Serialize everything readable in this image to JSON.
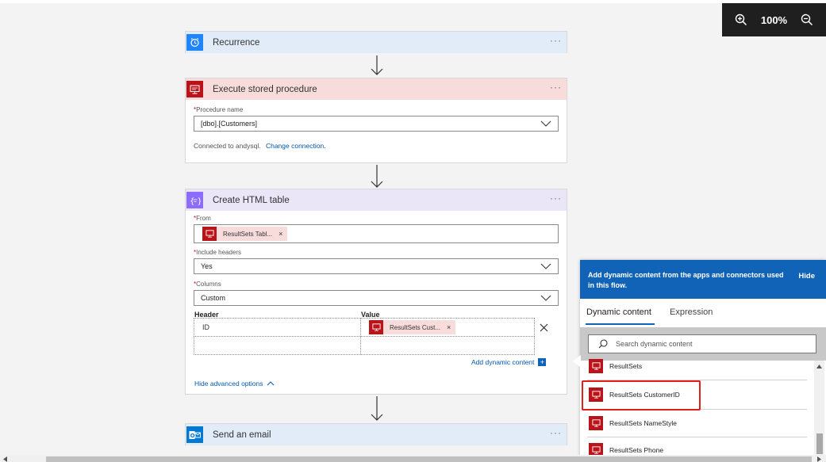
{
  "zoom": {
    "zoom_in_icon": "zoom-in-icon",
    "level": "100%",
    "zoom_out_icon": "zoom-out-icon"
  },
  "recurrence": {
    "title": "Recurrence",
    "more": "···"
  },
  "sql": {
    "title": "Execute stored procedure",
    "more": "···",
    "procedure_label": "Procedure name",
    "procedure_value": "[dbo].[Customers]",
    "connected_text": "Connected to andysql.",
    "change_connection": "Change connection."
  },
  "table": {
    "title": "Create HTML table",
    "more": "···",
    "from_label": "From",
    "from_token": "ResultSets Tabl...",
    "include_label": "Include headers",
    "include_value": "Yes",
    "columns_label": "Columns",
    "columns_value": "Custom",
    "header_col": "Header",
    "value_col": "Value",
    "row1_header": "ID",
    "row1_token": "ResultSets Cust...",
    "add_dynamic": "Add dynamic content",
    "hide_advanced": "Hide advanced options"
  },
  "email": {
    "title": "Send an email",
    "more": "···"
  },
  "dynamic_panel": {
    "heading": "Add dynamic content from the apps and connectors used in this flow.",
    "hide": "Hide",
    "tabs": [
      "Dynamic content",
      "Expression"
    ],
    "search_placeholder": "Search dynamic content",
    "items": [
      "ResultSets",
      "ResultSets CustomerID",
      "ResultSets NameStyle",
      "ResultSets Phone"
    ]
  },
  "colors": {
    "accent": "#1163b8",
    "sql": "#ba141a",
    "highlight": "#e0201b",
    "recurrence": "#1f85ff",
    "table_action": "#8c6cff"
  }
}
